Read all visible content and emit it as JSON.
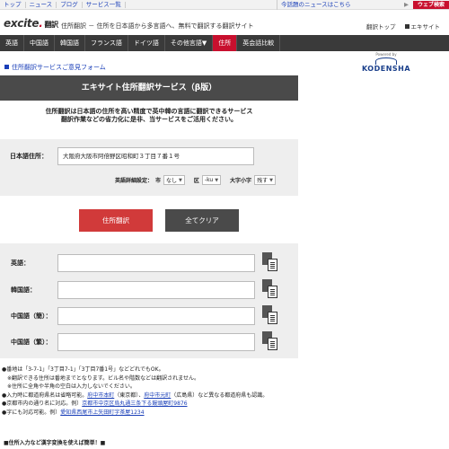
{
  "topbar": {
    "links": [
      "トップ",
      "ニュース",
      "ブログ",
      "サービス一覧"
    ],
    "news_label": "今話題のニュースはこちら",
    "news_arrow": "▶",
    "search_button": "ウェブ検索"
  },
  "brand": {
    "logo_text": "excite",
    "logo_dot": ".",
    "logo_sub": "翻訳",
    "tagline": "住所翻訳 － 住所を日本語から多言語へ、無料で翻訳する翻訳サイト",
    "right_links": [
      "翻訳トップ",
      "エキサイト"
    ]
  },
  "nav": {
    "items": [
      "英語",
      "中国語",
      "韓国語",
      "フランス語",
      "ドイツ語",
      "その他言語▼",
      "住所",
      "英会話比較"
    ],
    "active_index": 6
  },
  "feedback": {
    "label": "住所翻訳サービスご意見フォーム"
  },
  "partner": {
    "powered": "Powered by",
    "name": "KODENSHA"
  },
  "page": {
    "title": "エキサイト住所翻訳サービス（β版）",
    "intro_line1": "住所翻訳は日本語の住所を高い精度で英中韓の言語に翻訳できるサービス",
    "intro_line2": "翻訳作業などの省力化に是非、当サービスをご活用ください。"
  },
  "form": {
    "jp_label": "日本語住所：",
    "jp_value": "大阪府大阪市阿倍野区昭和町３丁目７番１号",
    "options_label": "英語詳細設定：",
    "opt_city_label": "市",
    "opt_city_value": "なし",
    "opt_ward_label": "区",
    "opt_ward_value": "-ku",
    "opt_case_label": "大字小字",
    "opt_case_value": "残す",
    "translate_button": "住所翻訳",
    "clear_button": "全てクリア"
  },
  "results": [
    {
      "label": "英語："
    },
    {
      "label": "韓国語："
    },
    {
      "label": "中国語（簡）："
    },
    {
      "label": "中国語（繁）："
    }
  ],
  "notes": {
    "line1": "●番地は「3-7-1」「3丁目7-1」「3丁目7番1号」などどれでもOK。",
    "line2": "※翻訳できる住所は番地までとなります。ビル名や階数などは翻訳されません。",
    "line3": "※住所に全角や半角の空白は入力しないでください。",
    "line4_pre": "●入力時に都道府県名は省略可能。",
    "line4_link1": "府中市本町",
    "line4_mid1": "（東京都）、",
    "line4_link2": "府中市元町",
    "line4_mid2": "（広島県）など異なる都道府県も認識。",
    "line5_pre": "●京都市内の通り名に対応。例）",
    "line5_link": "京都市中京区烏丸通三条下る饅頭屋町9876",
    "line6_pre": "●字にも対応可能。例）",
    "line6_link": "愛知県西尾市上矢田町字茶屋1234",
    "more": "■住所入力など漢字変換を使えば簡単！■"
  }
}
